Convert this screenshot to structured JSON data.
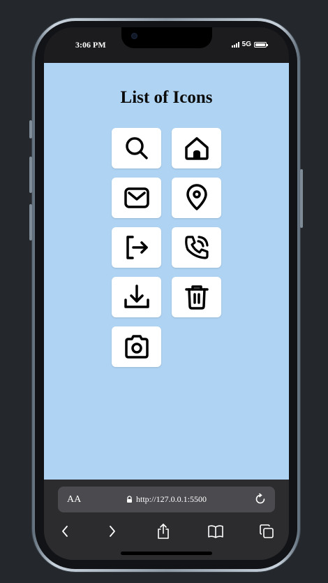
{
  "status": {
    "time": "3:06 PM",
    "network": "5G"
  },
  "page": {
    "title": "List of Icons",
    "background": "#afd3f2",
    "icons": [
      {
        "name": "search-icon"
      },
      {
        "name": "home-icon"
      },
      {
        "name": "mail-icon"
      },
      {
        "name": "location-pin-icon"
      },
      {
        "name": "logout-icon"
      },
      {
        "name": "phone-call-icon"
      },
      {
        "name": "download-icon"
      },
      {
        "name": "trash-icon"
      },
      {
        "name": "camera-icon"
      }
    ]
  },
  "browser": {
    "text_size_label": "AA",
    "url": "http://127.0.0.1:5500"
  }
}
